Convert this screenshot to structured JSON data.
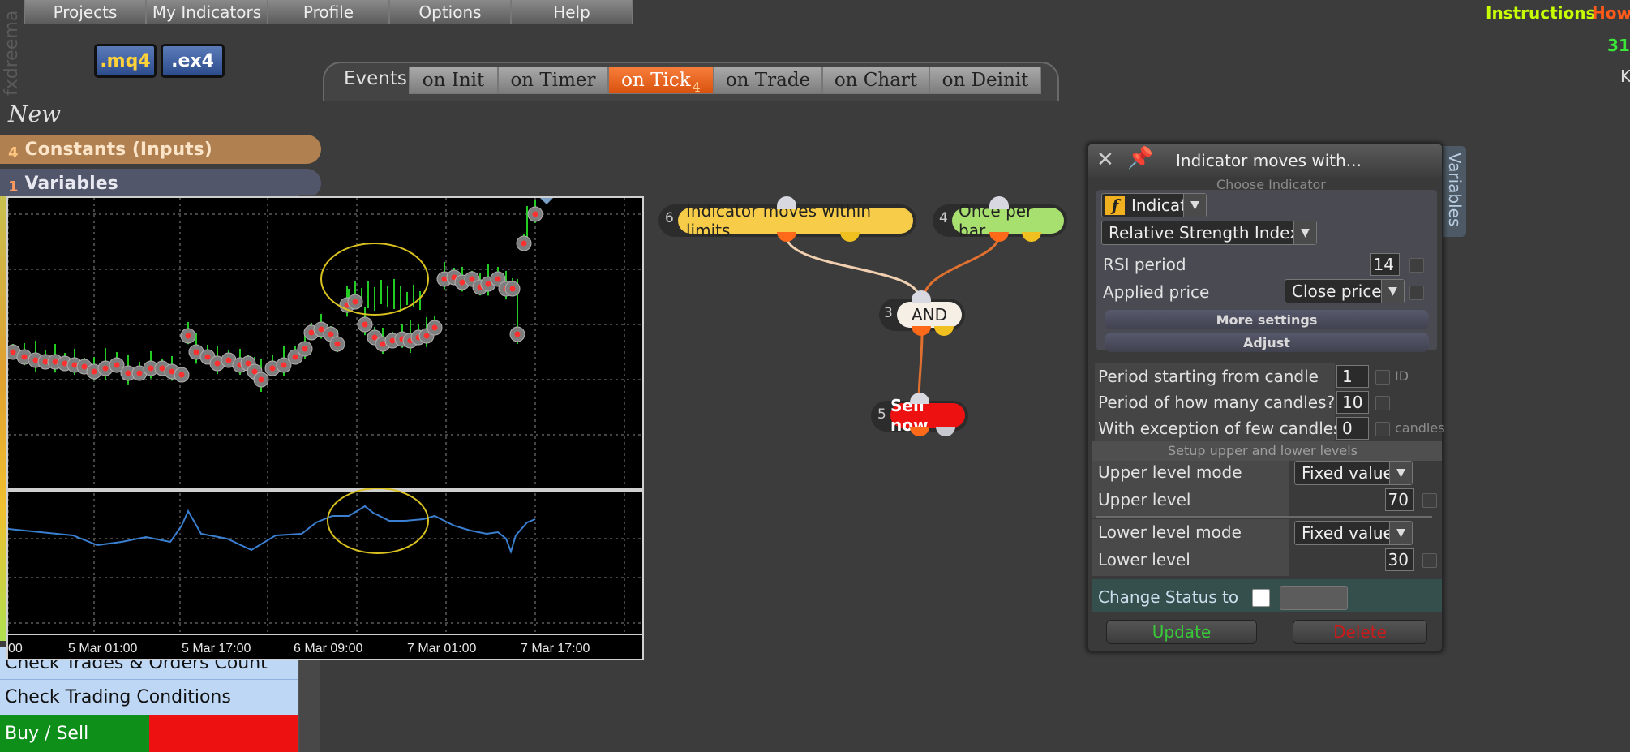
{
  "app": {
    "brand": "fxdreema",
    "menu": [
      "Projects",
      "My Indicators",
      "Profile",
      "Options",
      "Help"
    ],
    "instructions": "Instructions",
    "how_to": "How",
    "corner_number": "31",
    "corner_letter": "K"
  },
  "file_buttons": [
    ".mq4",
    ".ex4"
  ],
  "events": {
    "label": "Events",
    "tabs": [
      {
        "label": "on Init",
        "count": ""
      },
      {
        "label": "on Timer",
        "count": ""
      },
      {
        "label": "on Tick",
        "count": "4"
      },
      {
        "label": "on Trade",
        "count": ""
      },
      {
        "label": "on Chart",
        "count": ""
      },
      {
        "label": "on Deinit",
        "count": ""
      }
    ],
    "active": "on Tick"
  },
  "sidebar": {
    "new_label": "New",
    "constants": {
      "count": "4",
      "label": "Constants (Inputs)"
    },
    "variables": {
      "count": "1",
      "label": "Variables"
    },
    "blocks": [
      "Check Trades & Orders Count",
      "Check Trading Conditions",
      "Buy / Sell"
    ]
  },
  "chart_data": {
    "type": "line",
    "upper_panel": "price candles with pass markers",
    "lower_panel": "RSI line",
    "x_tick_labels": [
      "00",
      "5 Mar 01:00",
      "5 Mar 17:00",
      "6 Mar 09:00",
      "7 Mar 01:00",
      "7 Mar 17:00"
    ],
    "grid": true,
    "colors": {
      "candles": "#22cc22",
      "rsi": "#3a7fd0",
      "highlight": "#d8c020",
      "marker": "#ff3030"
    }
  },
  "flow": {
    "nodes": [
      {
        "id": "6",
        "label": "Indicator moves within limits",
        "color": "#f6cc48"
      },
      {
        "id": "4",
        "label": "Once per bar",
        "color": "#a8e070"
      },
      {
        "id": "3",
        "label": "AND",
        "color": "#f5efe6"
      },
      {
        "id": "5",
        "label": "Sell now",
        "color": "#ee1111"
      }
    ]
  },
  "dialog": {
    "title": "Indicator moves with...",
    "choose_indicator": "Choose Indicator",
    "indicator_type": "Indicator",
    "indicator_name": "Relative Strength Index",
    "rsi_period_label": "RSI period",
    "rsi_period_value": "14",
    "applied_price_label": "Applied price",
    "applied_price_value": "Close price",
    "more_settings": "More settings",
    "adjust": "Adjust",
    "period_start_label": "Period starting from candle",
    "period_start_value": "1",
    "period_start_suffix": "ID",
    "period_count_label": "Period of how many candles?",
    "period_count_value": "10",
    "exception_label": "With exception of few candles",
    "exception_value": "0",
    "exception_suffix": "candles",
    "levels_header": "Setup upper and lower levels",
    "upper_mode_label": "Upper level mode",
    "upper_mode_value": "Fixed value",
    "upper_level_label": "Upper level",
    "upper_level_value": "70",
    "lower_mode_label": "Lower level mode",
    "lower_mode_value": "Fixed value",
    "lower_level_label": "Lower level",
    "lower_level_value": "30",
    "change_status_label": "Change Status to",
    "update_label": "Update",
    "delete_label": "Delete",
    "variables_tab": "Variables"
  }
}
